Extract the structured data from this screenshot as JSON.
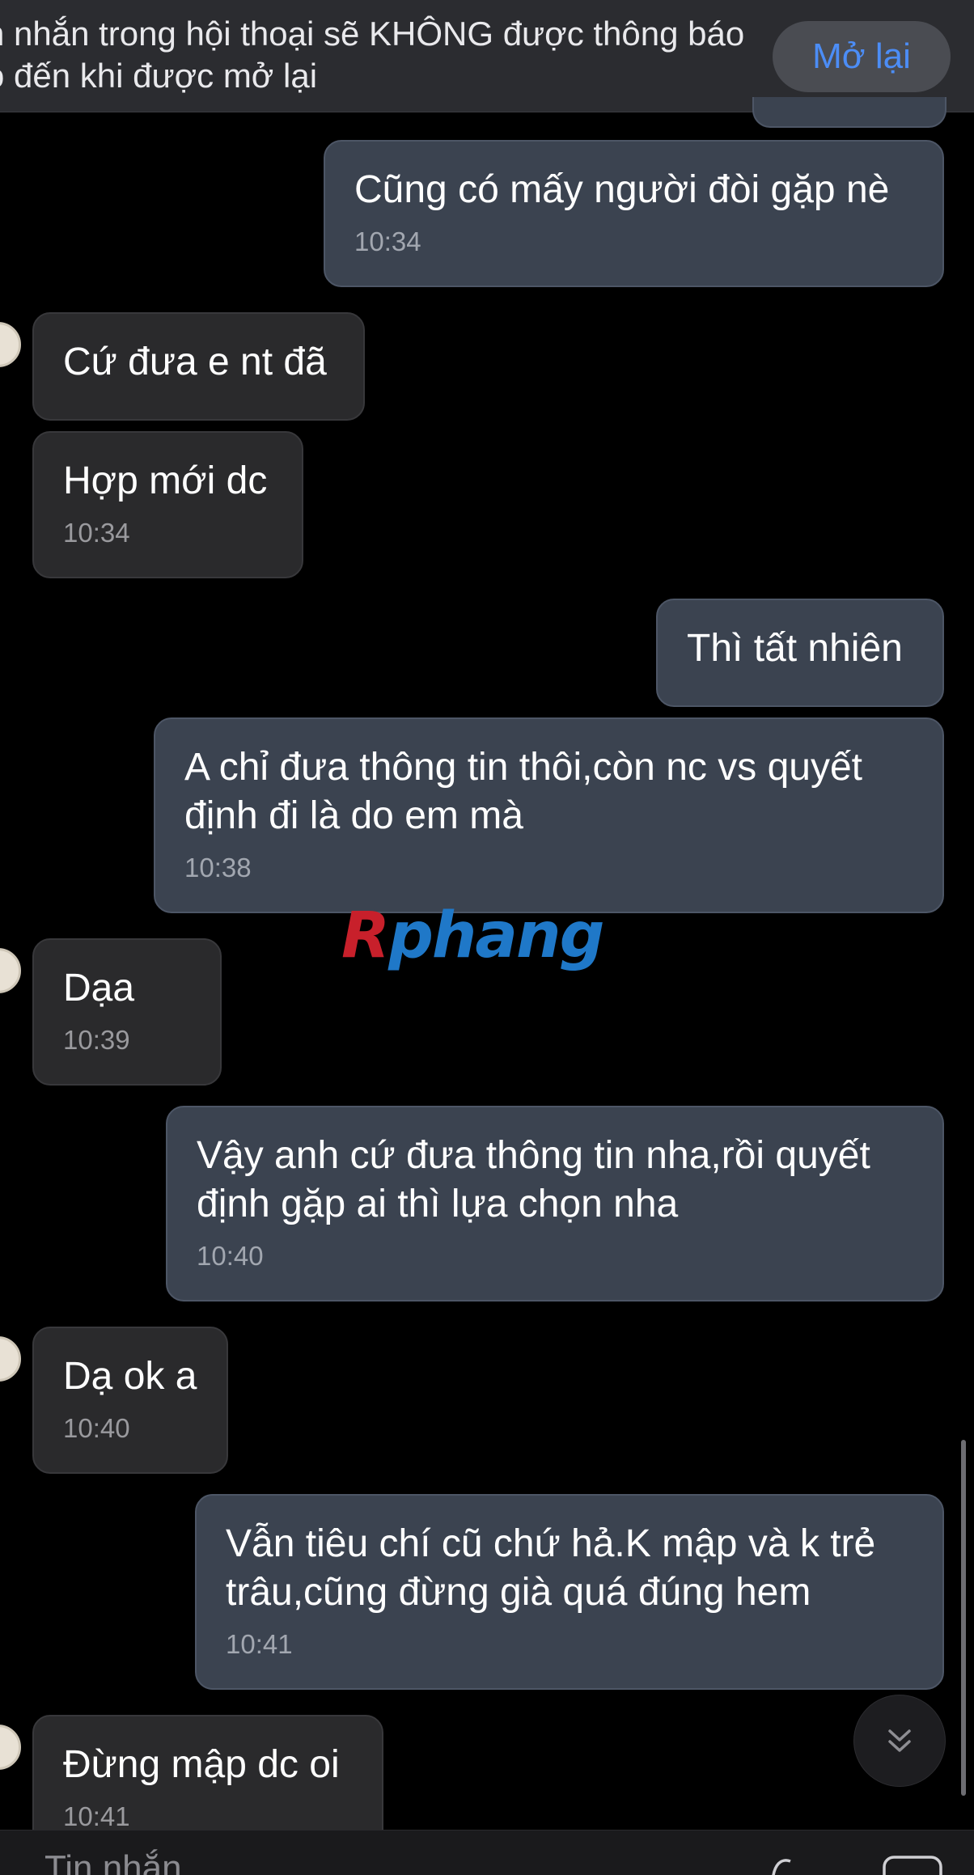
{
  "banner": {
    "text": "n nhắn trong hội thoại sẽ KHÔNG được thông báo\no đến khi được mở lại",
    "reopen_label": "Mở lại"
  },
  "messages": [
    {
      "side": "out",
      "text": "Cũng có mấy người đòi gặp nè",
      "time": "10:34"
    },
    {
      "side": "in",
      "text": "Cứ đưa e nt đã",
      "time": ""
    },
    {
      "side": "in",
      "text": "Hợp mới dc",
      "time": "10:34"
    },
    {
      "side": "out",
      "text": "Thì tất nhiên",
      "time": ""
    },
    {
      "side": "out",
      "text": "A chỉ đưa thông tin thôi,còn nc vs quyết định đi là do em mà",
      "time": "10:38"
    },
    {
      "side": "in",
      "text": "Dạa",
      "time": "10:39"
    },
    {
      "side": "out",
      "text": "Vậy anh cứ đưa thông tin nha,rồi quyết định gặp ai thì lựa chọn nha",
      "time": "10:40"
    },
    {
      "side": "in",
      "text": "Dạ ok a",
      "time": "10:40"
    },
    {
      "side": "out",
      "text": "Vẫn tiêu chí cũ chứ hả.K mập và k trẻ trâu,cũng đừng già quá đúng hem",
      "time": "10:41"
    },
    {
      "side": "in",
      "text": "Đừng mập dc oi",
      "time": "10:41"
    }
  ],
  "watermark": {
    "first": "R",
    "rest": "phang"
  },
  "composer": {
    "placeholder": "Tin nhắn"
  },
  "icons": {
    "scroll_down": "double-chevron-down-icon",
    "sticker": "sticker-icon",
    "image": "image-icon"
  }
}
